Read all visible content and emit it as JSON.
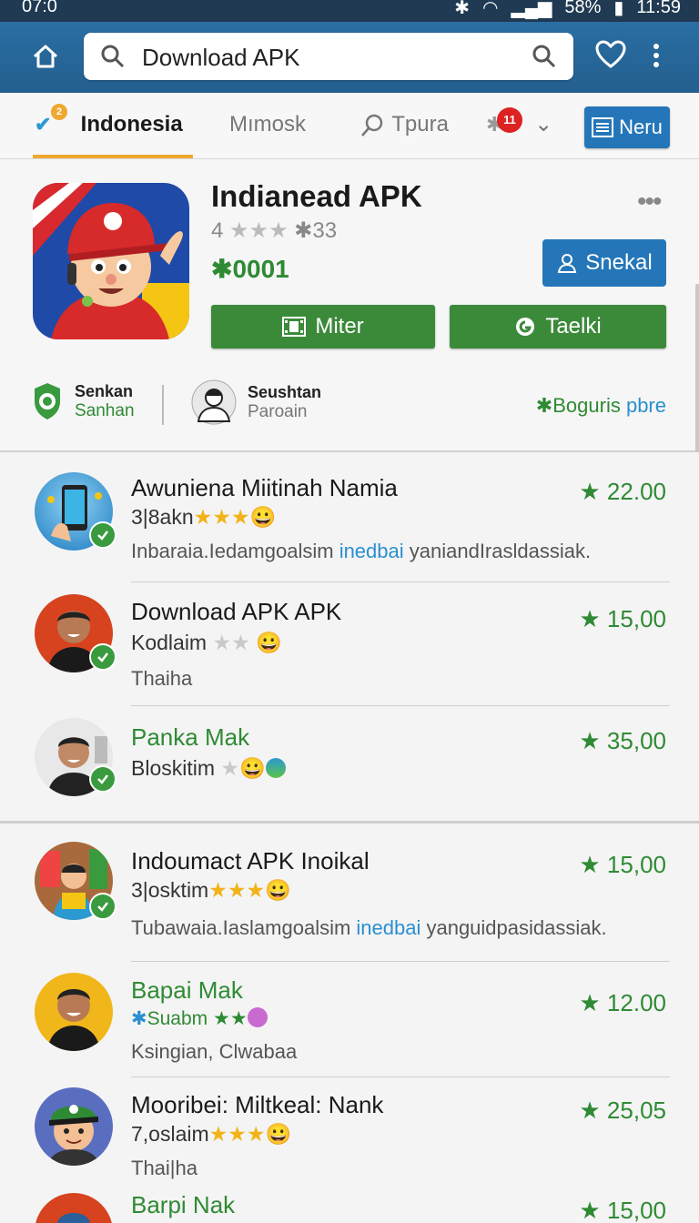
{
  "status_bar": {
    "time": "07:0",
    "battery": "58%",
    "clock": "11:59"
  },
  "search": {
    "value": "Download APK"
  },
  "tabs": {
    "items": [
      {
        "label": "Indonesia",
        "badge": "2"
      },
      {
        "label": "Mımosk"
      },
      {
        "label": "Tpura"
      },
      {
        "label": "",
        "badge": "11"
      }
    ],
    "menu_label": "Neru"
  },
  "app": {
    "title": "Indianead APK",
    "rating_value": "4",
    "rating_count": "33",
    "downloads": "0001",
    "primary_button": "Snekal",
    "button_1": "Miter",
    "button_2": "Taelki",
    "dev_1": {
      "name": "Senkan",
      "sub": "Sanhan"
    },
    "dev_2": {
      "name": "Seushtan",
      "sub": "Paroain"
    },
    "more_link_a": "Boguris ",
    "more_link_b": "pbre"
  },
  "list": [
    {
      "title": "Awuniena Miitinah Namia",
      "sub": "3|8akn",
      "stars": 3,
      "desc_a": "Inbaraia.Iedamgoalsim ",
      "desc_b": "inedbai",
      "desc_c": " yaniandIrasldassiak.",
      "price": "22.00"
    },
    {
      "title": "Download APK APK",
      "sub": "Kodlaim",
      "stars": 0,
      "grey_stars": 2,
      "desc": "Thaiha",
      "price": "15,00"
    },
    {
      "title": "Panka Mak",
      "sub": "Bloskitim",
      "stars": 0,
      "grey_stars": 1,
      "price": "35,00"
    },
    {
      "title": "Indoumact APK Inoikal",
      "sub": "3|osktim",
      "stars": 3,
      "desc_a": "Tubawaia.Iaslamgoalsim ",
      "desc_b": "inedbai",
      "desc_c": " yanguidpasidassiak.",
      "price": "15,00"
    },
    {
      "title": "Bapai Mak",
      "sub": "Suabm",
      "desc": "Ksingian, Clwabaa",
      "price": "12.00"
    },
    {
      "title": "Mooribei: Miltkeal: Nank",
      "sub": "7,oslaim",
      "stars": 3,
      "desc": "Thai|ha",
      "price": "25,05"
    },
    {
      "title": "Barpi Nak",
      "price": "15,00"
    }
  ],
  "colors": {
    "primary_blue": "#2576b8",
    "green": "#2f8a34",
    "tab_accent": "#f0a830",
    "star_yellow": "#f2b319"
  }
}
